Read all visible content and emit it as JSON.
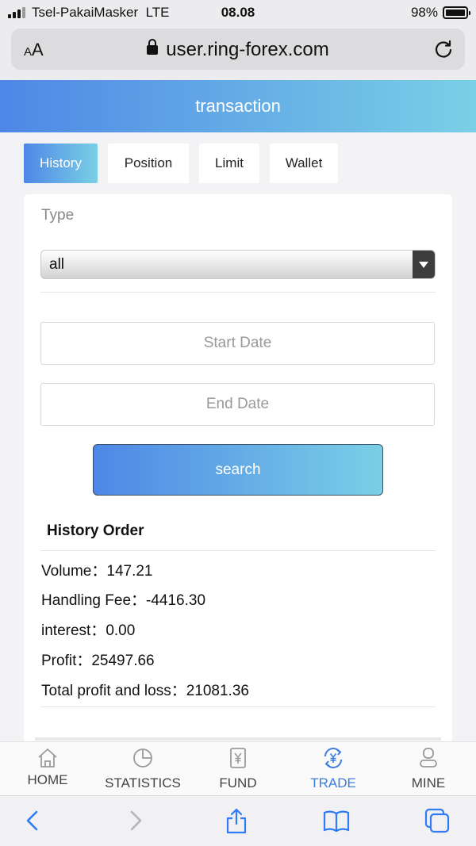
{
  "status_bar": {
    "carrier": "Tsel-PakaiMasker",
    "network": "LTE",
    "time": "08.08",
    "battery_percent": "98%",
    "battery_level": 0.98
  },
  "address_bar": {
    "text_size_label_small": "A",
    "text_size_label_large": "A",
    "url": "user.ring-forex.com"
  },
  "header": {
    "title": "transaction"
  },
  "tabs": [
    {
      "label": "History",
      "active": true
    },
    {
      "label": "Position",
      "active": false
    },
    {
      "label": "Limit",
      "active": false
    },
    {
      "label": "Wallet",
      "active": false
    }
  ],
  "filter": {
    "type_label": "Type",
    "type_value": "all",
    "start_date_placeholder": "Start Date",
    "end_date_placeholder": "End Date",
    "search_label": "search"
  },
  "history": {
    "title": "History Order",
    "rows": [
      {
        "label": "Volume：",
        "value": "147.21"
      },
      {
        "label": "Handling Fee：",
        "value": "-4416.30"
      },
      {
        "label": "interest：",
        "value": "0.00"
      },
      {
        "label": "Profit：",
        "value": "25497.66"
      },
      {
        "label": "Total profit and loss：",
        "value": "21081.36"
      }
    ]
  },
  "bottom_nav": [
    {
      "label": "HOME",
      "icon": "home-icon",
      "active": false
    },
    {
      "label": "STATISTICS",
      "icon": "pie-chart-icon",
      "active": false
    },
    {
      "label": "FUND",
      "icon": "yen-document-icon",
      "active": false
    },
    {
      "label": "TRADE",
      "icon": "yen-exchange-icon",
      "active": true
    },
    {
      "label": "MINE",
      "icon": "user-icon",
      "active": false
    }
  ],
  "browser_toolbar": [
    "back-icon",
    "forward-icon",
    "share-icon",
    "bookmarks-icon",
    "tabs-icon"
  ],
  "colors": {
    "accent_start": "#4e87e6",
    "accent_end": "#7ad0e6",
    "active_nav": "#3a7ee0"
  }
}
